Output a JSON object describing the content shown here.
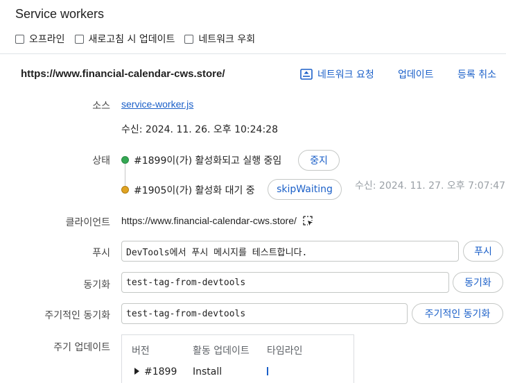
{
  "header": {
    "title": "Service workers"
  },
  "options": [
    {
      "label": "오프라인",
      "checked": false
    },
    {
      "label": "새로고침 시 업데이트",
      "checked": false
    },
    {
      "label": "네트워크 우회",
      "checked": false
    }
  ],
  "registration": {
    "origin": "https://www.financial-calendar-cws.store/",
    "actions": {
      "network_request": "네트워크 요청",
      "update": "업데이트",
      "unregister": "등록 취소"
    }
  },
  "labels": {
    "source": "소스",
    "status": "상태",
    "clients": "클라이언트",
    "push": "푸시",
    "sync": "동기화",
    "periodic_sync": "주기적인 동기화",
    "update_cycle": "주기 업데이트"
  },
  "source": {
    "file": "service-worker.js",
    "received": "수신: 2024. 11. 26. 오후 10:24:28"
  },
  "status": {
    "active": {
      "text": "#1899이(가) 활성화되고 실행 중임",
      "button": "중지",
      "color": "#34a853"
    },
    "waiting": {
      "text": "#1905이(가) 활성화 대기 중",
      "button": "skipWaiting",
      "color": "#e0a322",
      "received": "수신: 2024. 11. 27. 오후 7:07:47"
    }
  },
  "clients": {
    "url": "https://www.financial-calendar-cws.store/"
  },
  "push": {
    "value": "DevTools에서 푸시 메시지를 테스트합니다.",
    "button": "푸시"
  },
  "sync": {
    "value": "test-tag-from-devtools",
    "button": "동기화"
  },
  "periodic_sync": {
    "value": "test-tag-from-devtools",
    "button": "주기적인 동기화"
  },
  "update_cycle": {
    "columns": [
      "버전",
      "활동 업데이트",
      "타임라인"
    ],
    "rows": [
      {
        "version": "#1899",
        "activity": "Install"
      }
    ]
  },
  "colors": {
    "link": "#1a5fc8",
    "border": "#c4c7c5",
    "separator": "#dfe3e8"
  }
}
